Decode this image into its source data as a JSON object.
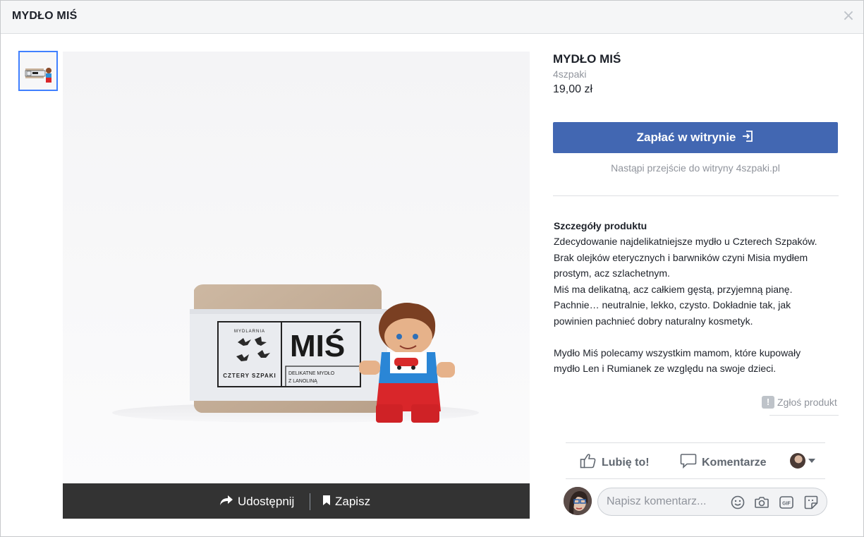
{
  "modal": {
    "title": "MYDŁO MIŚ",
    "close_glyph": "×"
  },
  "photo": {
    "thumbnail_alt": "product thumbnail",
    "product_image": {
      "box_brand_arc": "MYDLARNIA",
      "box_brand_name": "CZTERY SZPAKI",
      "box_product": "MIŚ",
      "box_subtitle_1": "DELIKATNE MYDŁO",
      "box_subtitle_2": "Z LANOLINĄ"
    },
    "share_label": "Udostępnij",
    "save_label": "Zapisz"
  },
  "product": {
    "title": "MYDŁO MIŚ",
    "seller": "4szpaki",
    "price": "19,00 zł",
    "pay_button": "Zapłać w witrynie",
    "redirect_note": "Nastąpi przejście do witryny 4szpaki.pl",
    "details_heading": "Szczegóły produktu",
    "details_lines": [
      "Zdecydowanie najdelikatniejsze mydło u Czterech Szpaków.",
      "Brak olejków eterycznych i barwników czyni Misia mydłem",
      "prostym, acz szlachetnym.",
      "Miś ma delikatną, acz całkiem gęstą, przyjemną pianę.",
      "Pachnie… neutralnie, lekko, czysto. Dokładnie tak, jak",
      "powinien pachnieć dobry naturalny kosmetyk.",
      "",
      "Mydło Miś polecamy wszystkim mamom, które kupowały",
      "mydło Len i Rumianek ze względu na swoje dzieci."
    ],
    "report_label": "Zgłoś produkt",
    "report_glyph": "!"
  },
  "actions": {
    "like_label": "Lubię to!",
    "comment_label": "Komentarze"
  },
  "comment": {
    "placeholder": "Napisz komentarz..."
  },
  "colors": {
    "accent": "#4267b2",
    "selected_border": "#4080ff",
    "photo_bar": "#333333"
  },
  "icons": [
    "close-icon",
    "share-icon",
    "bookmark-icon",
    "external-link-icon",
    "report-icon",
    "like-icon",
    "comment-icon",
    "chevron-down-icon",
    "emoji-icon",
    "camera-icon",
    "gif-icon",
    "sticker-icon"
  ]
}
